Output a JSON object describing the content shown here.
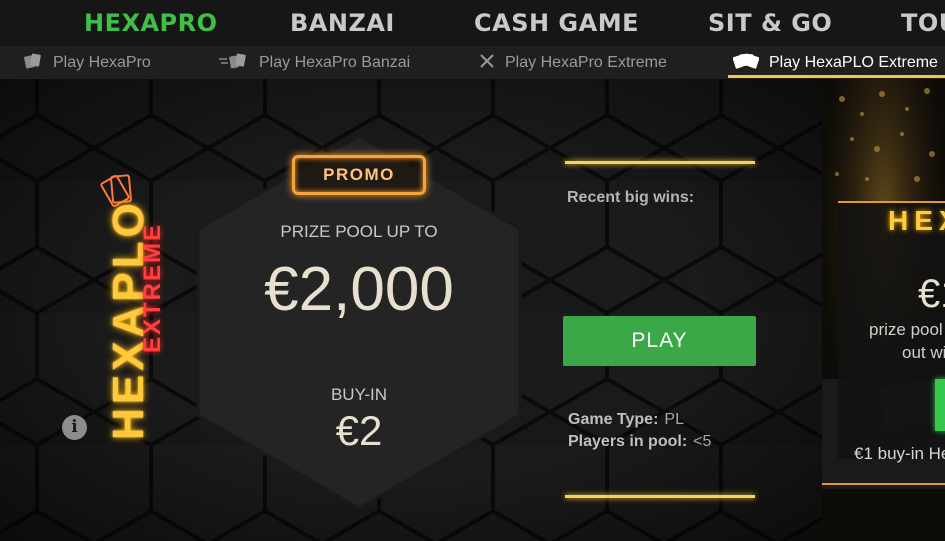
{
  "top_nav": {
    "tabs": [
      {
        "label": "HEXAPRO",
        "active": true
      },
      {
        "label": "BANZAI",
        "active": false
      },
      {
        "label": "CASH GAME",
        "active": false
      },
      {
        "label": "SIT & GO",
        "active": false
      },
      {
        "label": "TOU",
        "active": false
      }
    ]
  },
  "sub_nav": {
    "items": [
      {
        "label": "Play HexaPro",
        "icon": "cards-icon",
        "active": false
      },
      {
        "label": "Play HexaPro Banzai",
        "icon": "cards-speed-icon",
        "active": false
      },
      {
        "label": "Play HexaPro Extreme",
        "icon": "crossed-swords-icon",
        "active": false
      },
      {
        "label": "Play HexaPLO Extreme",
        "icon": "plo-cards-icon",
        "active": true
      }
    ]
  },
  "promo": {
    "badge": "PROMO",
    "prize_label": "PRIZE POOL UP TO",
    "prize_value": "€2,000",
    "buyin_label": "BUY-IN",
    "buyin_value": "€2"
  },
  "logo": {
    "word": "HEXAPLO",
    "sub": "EXTREME"
  },
  "right": {
    "recent_wins_label": "Recent big wins:",
    "play_label": "PLAY",
    "game_type_key": "Game Type:",
    "game_type_value": "PL",
    "players_key": "Players in pool:",
    "players_value": "<5"
  },
  "side_banner": {
    "title": "HEX",
    "amount": "€1",
    "line1": "prize pool",
    "line2": "out wi",
    "caption": "€1 buy-in He"
  },
  "colors": {
    "accent_green": "#3fbf48",
    "play_button": "#3aa846",
    "gold": "#f5d25a",
    "promo_orange": "#f4a43a",
    "neon_red": "#ff4040"
  }
}
